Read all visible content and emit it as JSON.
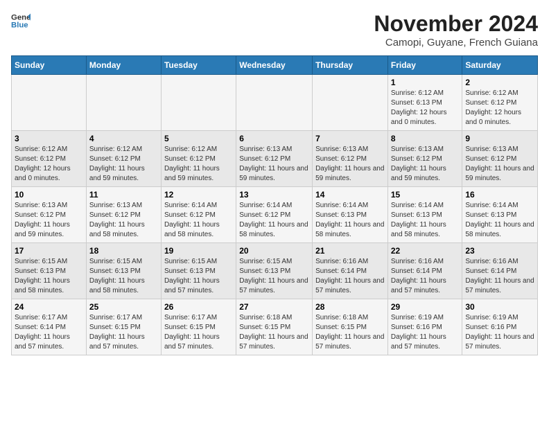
{
  "header": {
    "logo": {
      "general": "General",
      "blue": "Blue"
    },
    "month_year": "November 2024",
    "location": "Camopi, Guyane, French Guiana"
  },
  "weekdays": [
    "Sunday",
    "Monday",
    "Tuesday",
    "Wednesday",
    "Thursday",
    "Friday",
    "Saturday"
  ],
  "weeks": [
    [
      {
        "day": "",
        "info": ""
      },
      {
        "day": "",
        "info": ""
      },
      {
        "day": "",
        "info": ""
      },
      {
        "day": "",
        "info": ""
      },
      {
        "day": "",
        "info": ""
      },
      {
        "day": "1",
        "info": "Sunrise: 6:12 AM\nSunset: 6:13 PM\nDaylight: 12 hours and 0 minutes."
      },
      {
        "day": "2",
        "info": "Sunrise: 6:12 AM\nSunset: 6:12 PM\nDaylight: 12 hours and 0 minutes."
      }
    ],
    [
      {
        "day": "3",
        "info": "Sunrise: 6:12 AM\nSunset: 6:12 PM\nDaylight: 12 hours and 0 minutes."
      },
      {
        "day": "4",
        "info": "Sunrise: 6:12 AM\nSunset: 6:12 PM\nDaylight: 11 hours and 59 minutes."
      },
      {
        "day": "5",
        "info": "Sunrise: 6:12 AM\nSunset: 6:12 PM\nDaylight: 11 hours and 59 minutes."
      },
      {
        "day": "6",
        "info": "Sunrise: 6:13 AM\nSunset: 6:12 PM\nDaylight: 11 hours and 59 minutes."
      },
      {
        "day": "7",
        "info": "Sunrise: 6:13 AM\nSunset: 6:12 PM\nDaylight: 11 hours and 59 minutes."
      },
      {
        "day": "8",
        "info": "Sunrise: 6:13 AM\nSunset: 6:12 PM\nDaylight: 11 hours and 59 minutes."
      },
      {
        "day": "9",
        "info": "Sunrise: 6:13 AM\nSunset: 6:12 PM\nDaylight: 11 hours and 59 minutes."
      }
    ],
    [
      {
        "day": "10",
        "info": "Sunrise: 6:13 AM\nSunset: 6:12 PM\nDaylight: 11 hours and 59 minutes."
      },
      {
        "day": "11",
        "info": "Sunrise: 6:13 AM\nSunset: 6:12 PM\nDaylight: 11 hours and 58 minutes."
      },
      {
        "day": "12",
        "info": "Sunrise: 6:14 AM\nSunset: 6:12 PM\nDaylight: 11 hours and 58 minutes."
      },
      {
        "day": "13",
        "info": "Sunrise: 6:14 AM\nSunset: 6:12 PM\nDaylight: 11 hours and 58 minutes."
      },
      {
        "day": "14",
        "info": "Sunrise: 6:14 AM\nSunset: 6:13 PM\nDaylight: 11 hours and 58 minutes."
      },
      {
        "day": "15",
        "info": "Sunrise: 6:14 AM\nSunset: 6:13 PM\nDaylight: 11 hours and 58 minutes."
      },
      {
        "day": "16",
        "info": "Sunrise: 6:14 AM\nSunset: 6:13 PM\nDaylight: 11 hours and 58 minutes."
      }
    ],
    [
      {
        "day": "17",
        "info": "Sunrise: 6:15 AM\nSunset: 6:13 PM\nDaylight: 11 hours and 58 minutes."
      },
      {
        "day": "18",
        "info": "Sunrise: 6:15 AM\nSunset: 6:13 PM\nDaylight: 11 hours and 58 minutes."
      },
      {
        "day": "19",
        "info": "Sunrise: 6:15 AM\nSunset: 6:13 PM\nDaylight: 11 hours and 57 minutes."
      },
      {
        "day": "20",
        "info": "Sunrise: 6:15 AM\nSunset: 6:13 PM\nDaylight: 11 hours and 57 minutes."
      },
      {
        "day": "21",
        "info": "Sunrise: 6:16 AM\nSunset: 6:14 PM\nDaylight: 11 hours and 57 minutes."
      },
      {
        "day": "22",
        "info": "Sunrise: 6:16 AM\nSunset: 6:14 PM\nDaylight: 11 hours and 57 minutes."
      },
      {
        "day": "23",
        "info": "Sunrise: 6:16 AM\nSunset: 6:14 PM\nDaylight: 11 hours and 57 minutes."
      }
    ],
    [
      {
        "day": "24",
        "info": "Sunrise: 6:17 AM\nSunset: 6:14 PM\nDaylight: 11 hours and 57 minutes."
      },
      {
        "day": "25",
        "info": "Sunrise: 6:17 AM\nSunset: 6:15 PM\nDaylight: 11 hours and 57 minutes."
      },
      {
        "day": "26",
        "info": "Sunrise: 6:17 AM\nSunset: 6:15 PM\nDaylight: 11 hours and 57 minutes."
      },
      {
        "day": "27",
        "info": "Sunrise: 6:18 AM\nSunset: 6:15 PM\nDaylight: 11 hours and 57 minutes."
      },
      {
        "day": "28",
        "info": "Sunrise: 6:18 AM\nSunset: 6:15 PM\nDaylight: 11 hours and 57 minutes."
      },
      {
        "day": "29",
        "info": "Sunrise: 6:19 AM\nSunset: 6:16 PM\nDaylight: 11 hours and 57 minutes."
      },
      {
        "day": "30",
        "info": "Sunrise: 6:19 AM\nSunset: 6:16 PM\nDaylight: 11 hours and 57 minutes."
      }
    ]
  ]
}
